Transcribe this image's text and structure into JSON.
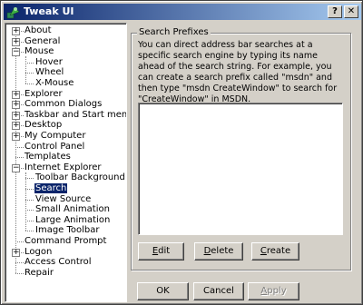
{
  "window": {
    "title": "Tweak UI",
    "help_label": "?",
    "close_label": "✕"
  },
  "tree": {
    "items": [
      {
        "label": "About",
        "expander": "+"
      },
      {
        "label": "General",
        "expander": "+"
      },
      {
        "label": "Mouse",
        "expander": "−"
      },
      {
        "label": "Hover"
      },
      {
        "label": "Wheel"
      },
      {
        "label": "X-Mouse"
      },
      {
        "label": "Explorer",
        "expander": "+"
      },
      {
        "label": "Common Dialogs",
        "expander": "+"
      },
      {
        "label": "Taskbar and Start menu",
        "expander": "+"
      },
      {
        "label": "Desktop",
        "expander": "+"
      },
      {
        "label": "My Computer",
        "expander": "+"
      },
      {
        "label": "Control Panel"
      },
      {
        "label": "Templates"
      },
      {
        "label": "Internet Explorer",
        "expander": "−"
      },
      {
        "label": "Toolbar Background"
      },
      {
        "label": "Search",
        "selected": true
      },
      {
        "label": "View Source"
      },
      {
        "label": "Small Animation"
      },
      {
        "label": "Large Animation"
      },
      {
        "label": "Image Toolbar"
      },
      {
        "label": "Command Prompt"
      },
      {
        "label": "Logon",
        "expander": "+"
      },
      {
        "label": "Access Control"
      },
      {
        "label": "Repair"
      }
    ]
  },
  "panel": {
    "group_title": "Search Prefixes",
    "description": "You can direct address bar searches at a specific search engine by typing its name ahead of the search string. For example, you can create a search prefix called \"msdn\" and then type \"msdn CreateWindow\" to search for \"CreateWindow\" in MSDN.",
    "buttons": {
      "edit": {
        "first": "E",
        "rest": "dit"
      },
      "delete": {
        "first": "D",
        "rest": "elete"
      },
      "create": {
        "first": "C",
        "rest": "reate"
      }
    }
  },
  "footer": {
    "ok_label": "OK",
    "cancel_label": "Cancel",
    "apply": {
      "first": "A",
      "rest": "pply"
    }
  },
  "colors": {
    "titlebar_start": "#0a246a",
    "titlebar_end": "#a6caf0",
    "selection": "#0a246a",
    "face": "#d4d0c8"
  }
}
